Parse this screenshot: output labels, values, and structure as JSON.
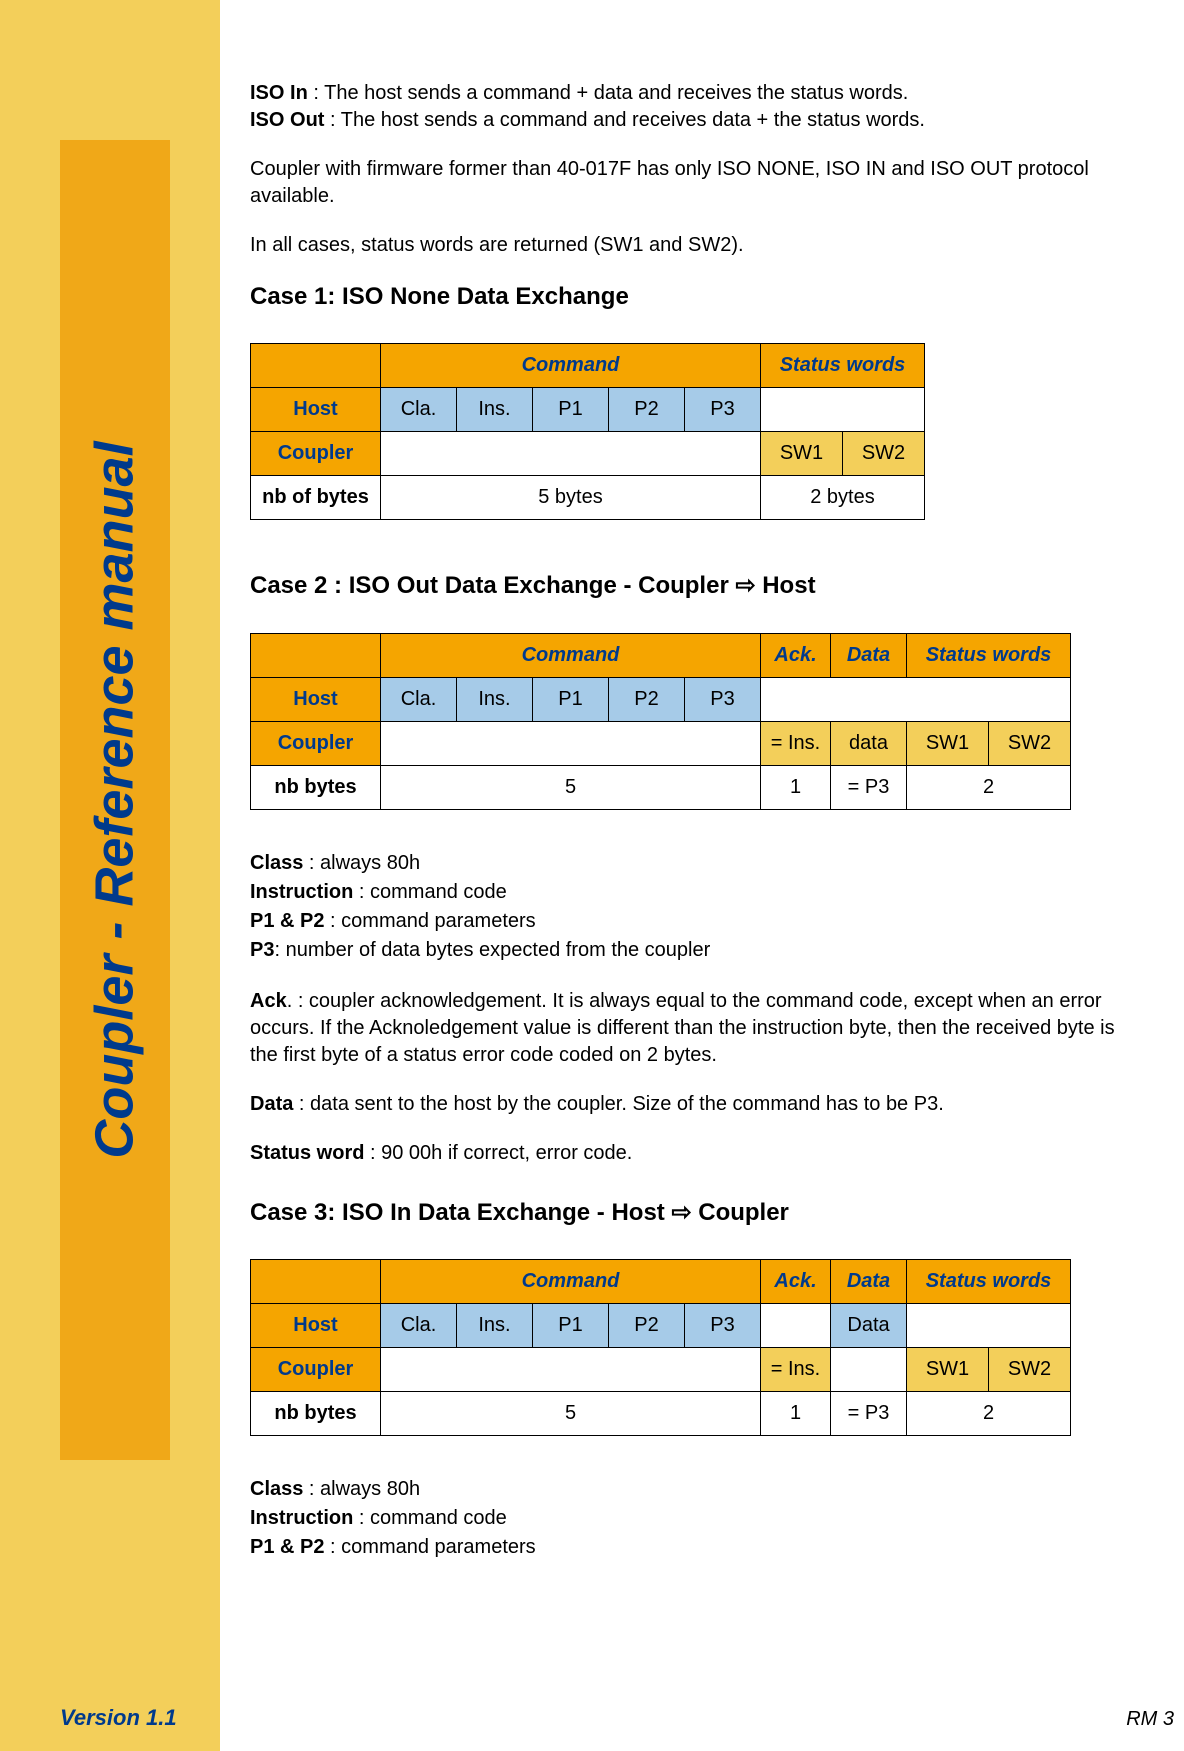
{
  "sidebar": {
    "title": "Coupler - Reference manual",
    "version": "Version 1.1",
    "footer_right": "RM 3"
  },
  "intro": {
    "iso_in_label": "ISO In",
    "iso_in_text": " : The host sends a command + data and receives the status words.",
    "iso_out_label": "ISO Out",
    "iso_out_text": " : The host sends a command and receives data + the status words.",
    "firmware": "Coupler with firmware former than 40-017F has only ISO NONE, ISO IN and ISO OUT protocol available.",
    "status_return": "In all cases, status words are returned (SW1 and SW2)."
  },
  "case1": {
    "title": "Case 1: ISO None Data Exchange",
    "hdr_command": "Command",
    "hdr_status": "Status words",
    "row_host": "Host",
    "row_coupler": "Coupler",
    "row_nb": "nb of bytes",
    "cells": {
      "cla": "Cla.",
      "ins": "Ins.",
      "p1": "P1",
      "p2": "P2",
      "p3": "P3",
      "sw1": "SW1",
      "sw2": "SW2"
    },
    "bytes_5": "5 bytes",
    "bytes_2": "2 bytes"
  },
  "case2": {
    "title": "Case 2 : ISO Out Data Exchange - Coupler ⇨ Host",
    "hdr_command": "Command",
    "hdr_ack": "Ack.",
    "hdr_data": "Data",
    "hdr_status": "Status words",
    "row_host": "Host",
    "row_coupler": "Coupler",
    "row_nb": "nb bytes",
    "cells": {
      "cla": "Cla.",
      "ins": "Ins.",
      "p1": "P1",
      "p2": "P2",
      "p3": "P3",
      "ack": "= Ins.",
      "data": "data",
      "sw1": "SW1",
      "sw2": "SW2"
    },
    "nb": {
      "cmd": "5",
      "ack": "1",
      "data": "= P3",
      "status": "2"
    }
  },
  "defs2": {
    "class_l": "Class",
    "class_t": " : always 80h",
    "inst_l": "Instruction",
    "inst_t": " : command code",
    "p12_l": "P1 & P2",
    "p12_t": " : command parameters",
    "p3_l": "P3",
    "p3_t": ": number of data bytes expected from the coupler",
    "ack_l": "Ack",
    "ack_t": ". : coupler acknowledgement. It is always equal to the command code, except when an error occurs. If the Acknoledgement value is different than the instruction byte, then the received byte is the first byte of a status error code coded on 2 bytes.",
    "data_l": "Data",
    "data_t": " : data sent to the host by the coupler. Size of the command has to be P3.",
    "sw_l": "Status word",
    "sw_t": " : 90 00h if correct, error code."
  },
  "case3": {
    "title": "Case 3: ISO In Data Exchange - Host ⇨ Coupler",
    "hdr_command": "Command",
    "hdr_ack": "Ack.",
    "hdr_data": "Data",
    "hdr_status": "Status words",
    "row_host": "Host",
    "row_coupler": "Coupler",
    "row_nb": "nb bytes",
    "cells": {
      "cla": "Cla.",
      "ins": "Ins.",
      "p1": "P1",
      "p2": "P2",
      "p3": "P3",
      "ack": "= Ins.",
      "data_host": "Data",
      "sw1": "SW1",
      "sw2": "SW2"
    },
    "nb": {
      "cmd": "5",
      "ack": "1",
      "data": "= P3",
      "status": "2"
    }
  },
  "defs3": {
    "class_l": "Class",
    "class_t": " : always 80h",
    "inst_l": "Instruction",
    "inst_t": " : command code",
    "p12_l": "P1 & P2",
    "p12_t": " : command parameters"
  }
}
